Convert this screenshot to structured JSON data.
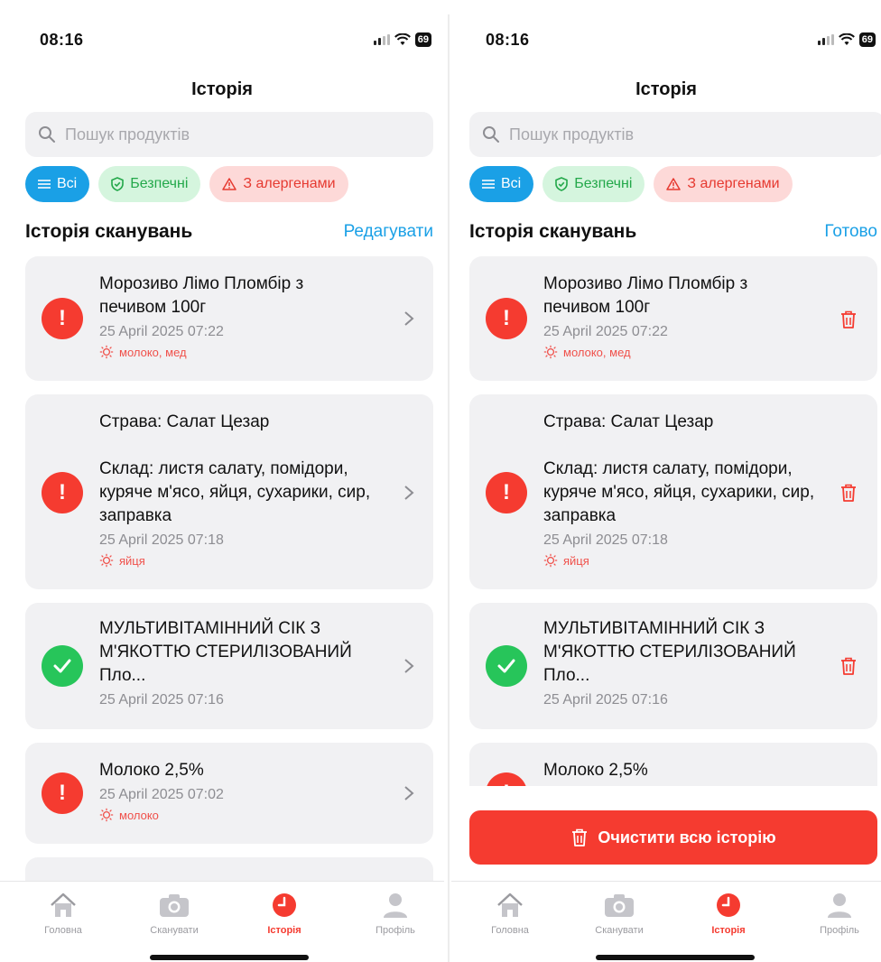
{
  "status_bar": {
    "time": "08:16",
    "battery": "69"
  },
  "left": {
    "title": "Історія",
    "search": {
      "placeholder": "Пошук продуктів"
    },
    "filters": {
      "all": "Всі",
      "safe": "Безпечні",
      "allergens": "З алергенами"
    },
    "section": {
      "title": "Історія сканувань",
      "action": "Редагувати"
    },
    "items": [
      {
        "name": "Морозиво Лімо Пломбір з печивом 100г",
        "date": "25 April 2025  07:22",
        "allergens": "молоко, мед",
        "status": "danger"
      },
      {
        "name_line1": "Страва: Салат Цезар",
        "name_line2": "Склад: листя салату, помідори, куряче м'ясо, яйця, сухарики, сир, заправка",
        "date": "25 April 2025  07:18",
        "allergens": "яйця",
        "status": "danger"
      },
      {
        "name": "МУЛЬТИВІТАМІННИЙ СІК З М'ЯКОТТЮ СТЕРИЛІЗОВАНИЙ Пло...",
        "date": "25 April 2025  07:16",
        "status": "ok"
      },
      {
        "name": "Молоко 2,5%",
        "date": "25 April 2025  07:02",
        "allergens": "молоко",
        "status": "danger"
      }
    ]
  },
  "right": {
    "title": "Історія",
    "search": {
      "placeholder": "Пошук продуктів"
    },
    "filters": {
      "all": "Всі",
      "safe": "Безпечні",
      "allergens": "З алергенами"
    },
    "section": {
      "title": "Історія сканувань",
      "action": "Готово"
    },
    "items": [
      {
        "name": "Морозиво Лімо Пломбір з печивом 100г",
        "date": "25 April 2025  07:22",
        "allergens": "молоко, мед",
        "status": "danger"
      },
      {
        "name_line1": "Страва: Салат Цезар",
        "name_line2": "Склад: листя салату, помідори, куряче м'ясо, яйця, сухарики, сир, заправка",
        "date": "25 April 2025  07:18",
        "allergens": "яйця",
        "status": "danger"
      },
      {
        "name": "МУЛЬТИВІТАМІННИЙ СІК З М'ЯКОТТЮ СТЕРИЛІЗОВАНИЙ Пло...",
        "date": "25 April 2025  07:16",
        "status": "ok"
      },
      {
        "name": "Молоко 2,5%",
        "status": "danger"
      }
    ],
    "clear_button": "Очистити всю історію"
  },
  "tabs": {
    "home": "Головна",
    "scan": "Сканувати",
    "history": "Історія",
    "profile": "Профіль"
  },
  "colors": {
    "accent": "#1aa0e6",
    "danger": "#f53b30",
    "safe": "#27c55a"
  },
  "icons": [
    "search-icon",
    "list-icon",
    "shield-check-icon",
    "warning-icon",
    "chevron-right-icon",
    "trash-icon",
    "allergen-icon",
    "home-icon",
    "camera-icon",
    "clock-icon",
    "person-icon",
    "wifi-icon",
    "signal-icon",
    "battery-icon"
  ]
}
